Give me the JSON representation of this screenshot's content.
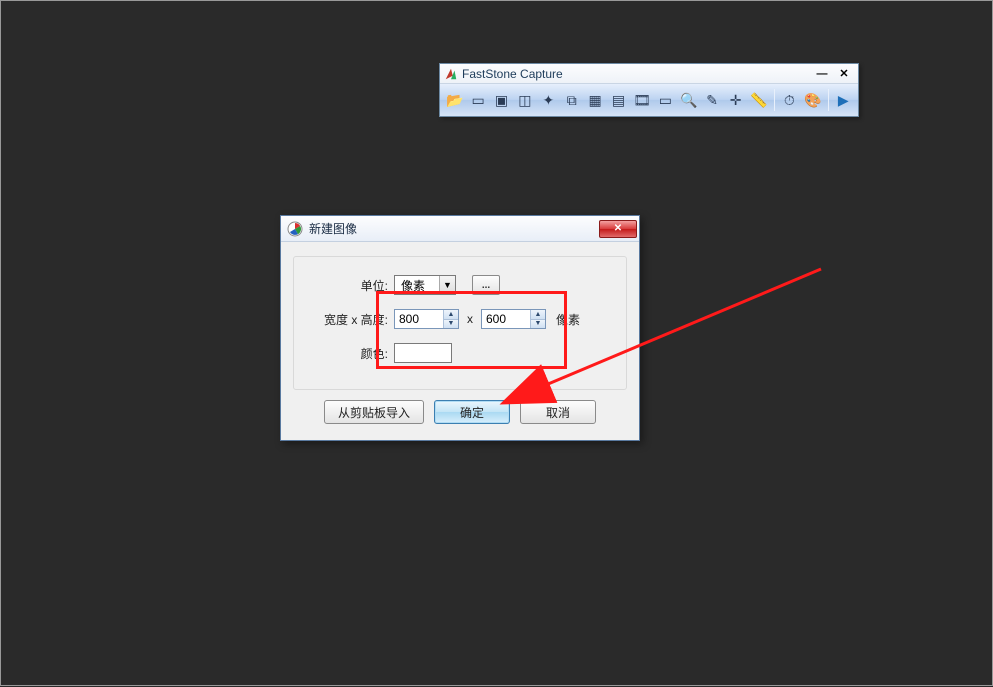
{
  "toolbar": {
    "title": "FastStone Capture",
    "buttons": [
      {
        "name": "open-icon"
      },
      {
        "name": "capture-window-icon"
      },
      {
        "name": "capture-region-icon"
      },
      {
        "name": "capture-freehand-icon"
      },
      {
        "name": "capture-shape-icon"
      },
      {
        "name": "capture-fullscreen-icon"
      },
      {
        "name": "capture-scroll-icon"
      },
      {
        "name": "capture-fixed-icon"
      },
      {
        "name": "capture-video-icon"
      },
      {
        "name": "capture-rect-icon"
      },
      {
        "name": "magnifier-icon"
      },
      {
        "name": "picker-icon"
      },
      {
        "name": "crosshair-icon"
      },
      {
        "name": "ruler-icon"
      },
      {
        "name": "timer-icon"
      },
      {
        "name": "palette-icon"
      },
      {
        "name": "menu-icon"
      }
    ]
  },
  "dialog": {
    "title": "新建图像",
    "labels": {
      "unit": "单位:",
      "size": "宽度 x 高度:",
      "color": "颜色:",
      "x_sep": "x",
      "suffix_unit": "像素"
    },
    "values": {
      "unit_selected": "像素",
      "width": "800",
      "height": "600",
      "color_hex": "#ffffff"
    },
    "buttons": {
      "more": "...",
      "paste": "从剪贴板导入",
      "ok": "确定",
      "cancel": "取消"
    }
  }
}
